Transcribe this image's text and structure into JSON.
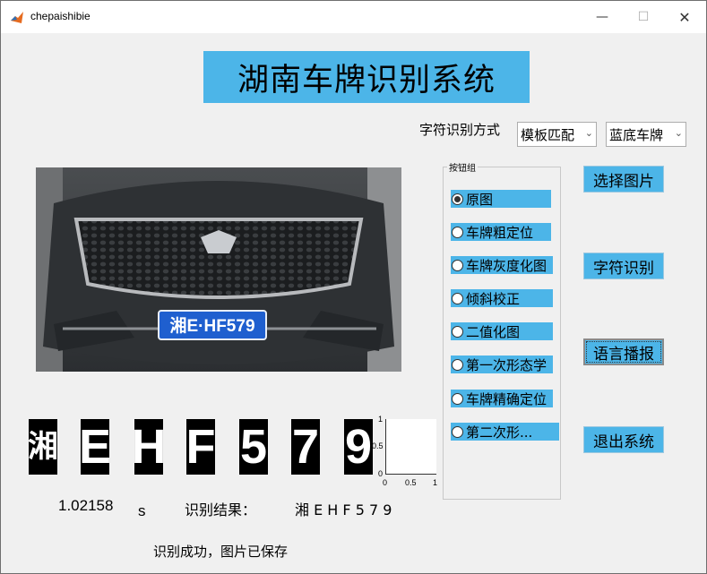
{
  "window": {
    "title": "chepaishibie",
    "minimize": "—",
    "maximize": "☐",
    "close": "✕"
  },
  "header": {
    "system_title": "湖南车牌识别系统"
  },
  "controls": {
    "method_label": "字符识别方式",
    "method_select": "模板匹配",
    "plate_select": "蓝底车牌",
    "dropdown_arrow": "⌄"
  },
  "photo": {
    "plate_text": "湘E·HF579"
  },
  "button_group": {
    "legend": "按钮组",
    "options": [
      "原图",
      "车牌粗定位",
      "车牌灰度化图",
      "倾斜校正",
      "二值化图",
      "第一次形态学",
      "车牌精确定位",
      "第二次形..."
    ],
    "selected_index": 0
  },
  "buttons": {
    "select_image": "选择图片",
    "char_recognize": "字符识别",
    "voice": "语言播报",
    "exit": "退出系统"
  },
  "segmented_chars": [
    "湘",
    "E",
    "H",
    "F",
    "5",
    "7",
    "9"
  ],
  "axes": {
    "y_ticks": [
      "1",
      "0.5",
      "0"
    ],
    "x_ticks": [
      "0",
      "0.5",
      "1"
    ]
  },
  "results": {
    "elapsed_value": "1.02158",
    "elapsed_unit": "s",
    "result_label": "识别结果：",
    "result_value": "湘 E H F 5 7 9",
    "status": "识别成功，图片已保存"
  },
  "colors": {
    "accent": "#4cb5e8",
    "window_bg": "#f0f0f0"
  }
}
